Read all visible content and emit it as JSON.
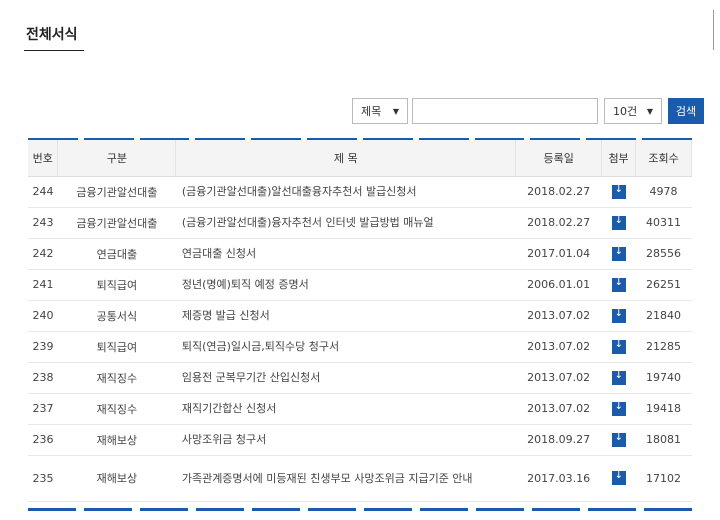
{
  "page": {
    "title": "전체서식"
  },
  "search": {
    "field_select": "제목",
    "input_value": "",
    "count_select": "10건",
    "button_label": "검색"
  },
  "table": {
    "headers": [
      "번호",
      "구분",
      "제 목",
      "등록일",
      "첨부",
      "조회수"
    ],
    "rows": [
      {
        "num": "244",
        "category": "금융기관알선대출",
        "title": "(금융기관알선대출)알선대출융자추천서 발급신청서",
        "date": "2018.02.27",
        "attach": "file-download-icon",
        "views": "4978"
      },
      {
        "num": "243",
        "category": "금융기관알선대출",
        "title": "(금융기관알선대출)융자추천서 인터넷 발급방법 매뉴얼",
        "date": "2018.02.27",
        "attach": "file-download-icon",
        "views": "40311"
      },
      {
        "num": "242",
        "category": "연금대출",
        "title": "연금대출 신청서",
        "date": "2017.01.04",
        "attach": "file-download-icon",
        "views": "28556"
      },
      {
        "num": "241",
        "category": "퇴직급여",
        "title": "정년(명예)퇴직 예정 증명서",
        "date": "2006.01.01",
        "attach": "file-download-icon",
        "views": "26251"
      },
      {
        "num": "240",
        "category": "공통서식",
        "title": "제증명 발급 신청서",
        "date": "2013.07.02",
        "attach": "file-download-icon",
        "views": "21840"
      },
      {
        "num": "239",
        "category": "퇴직급여",
        "title": "퇴직(연금)일시금,퇴직수당 청구서",
        "date": "2013.07.02",
        "attach": "file-download-icon",
        "views": "21285"
      },
      {
        "num": "238",
        "category": "재직징수",
        "title": "임용전 군복무기간 산입신청서",
        "date": "2013.07.02",
        "attach": "file-download-icon",
        "views": "19740"
      },
      {
        "num": "237",
        "category": "재직징수",
        "title": "재직기간합산 신청서",
        "date": "2013.07.02",
        "attach": "file-download-icon",
        "views": "19418"
      },
      {
        "num": "236",
        "category": "재해보상",
        "title": "사망조위금 청구서",
        "date": "2018.09.27",
        "attach": "file-download-icon",
        "views": "18081"
      },
      {
        "num": "235",
        "category": "재해보상",
        "title": "가족관계증명서에 미등재된 친생부모 사망조위금 지급기준 안내",
        "date": "2017.03.16",
        "attach": "file-download-icon",
        "views": "17102"
      }
    ]
  },
  "colors": {
    "accent": "#1a5bab",
    "header_bg": "#f4f4f4"
  }
}
